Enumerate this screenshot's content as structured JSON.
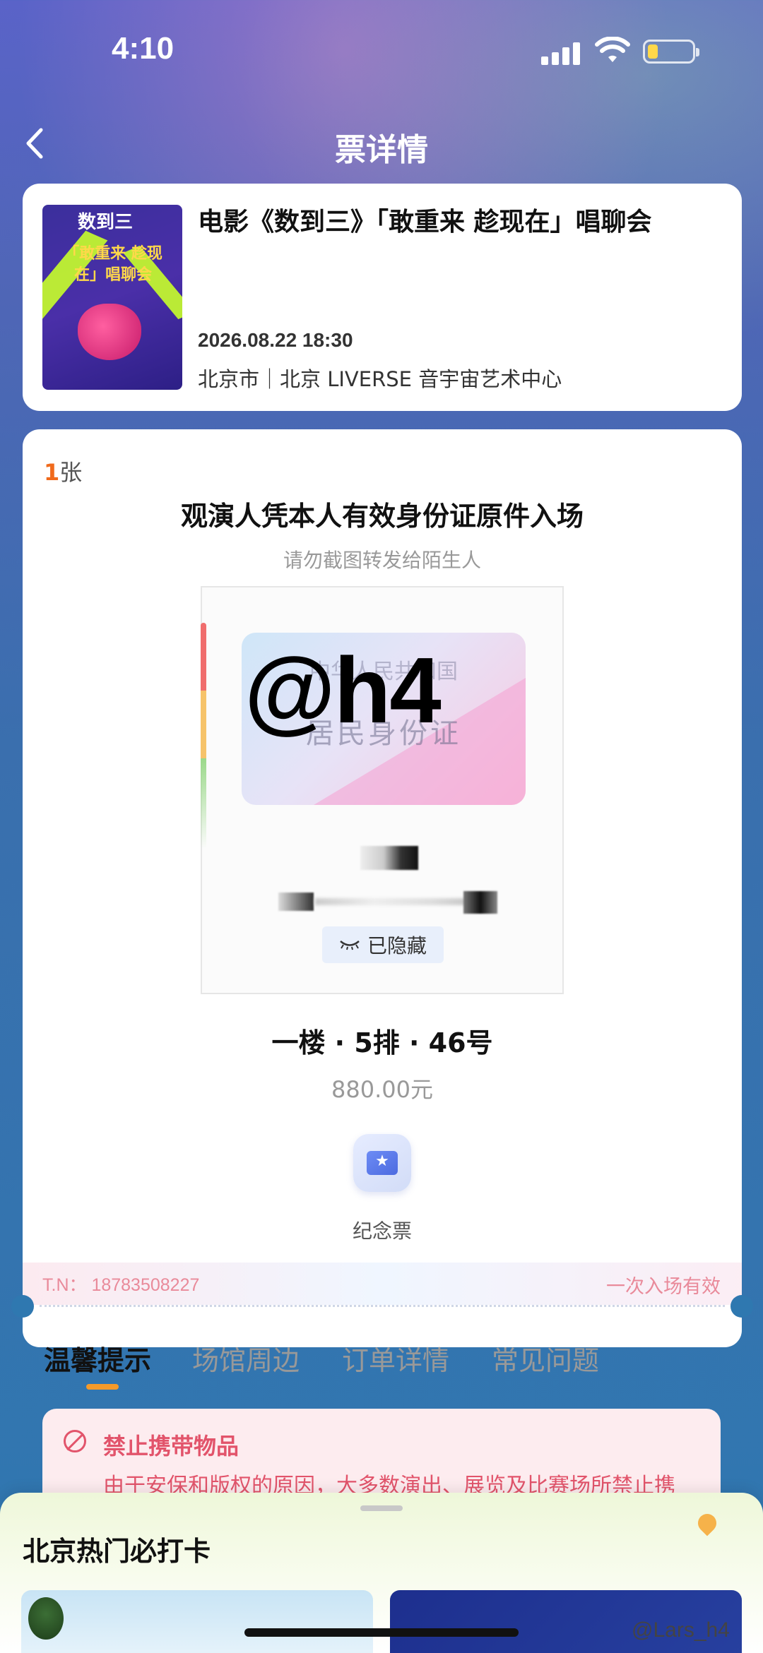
{
  "status_bar": {
    "time": "4:10"
  },
  "header": {
    "title": "票详情"
  },
  "event": {
    "poster_logo": "数到三",
    "poster_title": "「敢重来 趁现在」唱聊会",
    "title": "电影《数到三》「敢重来 趁现在」唱聊会",
    "datetime": "2026.08.22 18:30",
    "venue": "北京市｜北京 LIVERSE 音宇宙艺术中心"
  },
  "ticket": {
    "count_number": "1",
    "count_unit": "张",
    "entry_rule": "观演人凭本人有效身份证原件入场",
    "warning": "请勿截图转发给陌生人",
    "id_card_faint_text": "中华人民共和国",
    "id_card_label": "居民身份证",
    "watermark": "@h4",
    "hidden_label": "已隐藏",
    "seat": "一楼 · 5排 · 46号",
    "price": "880.00元",
    "souvenir_label": "纪念票",
    "tn": "T.N：  18783508227",
    "entry_once": "一次入场有效"
  },
  "tabs": [
    {
      "label": "温馨提示"
    },
    {
      "label": "场馆周边"
    },
    {
      "label": "订单详情"
    },
    {
      "label": "常见问题"
    }
  ],
  "notice": {
    "title": "禁止携带物品",
    "text": "由于安保和版权的原因，大多数演出、展览及比赛场所禁止携"
  },
  "bottom_sheet": {
    "title": "北京热门必打卡"
  },
  "footer_watermark": "@Lars_h4",
  "colors": {
    "accent_orange": "#f59a2a",
    "warning_red": "#e2546b",
    "tn_pink": "#e98a9a"
  }
}
